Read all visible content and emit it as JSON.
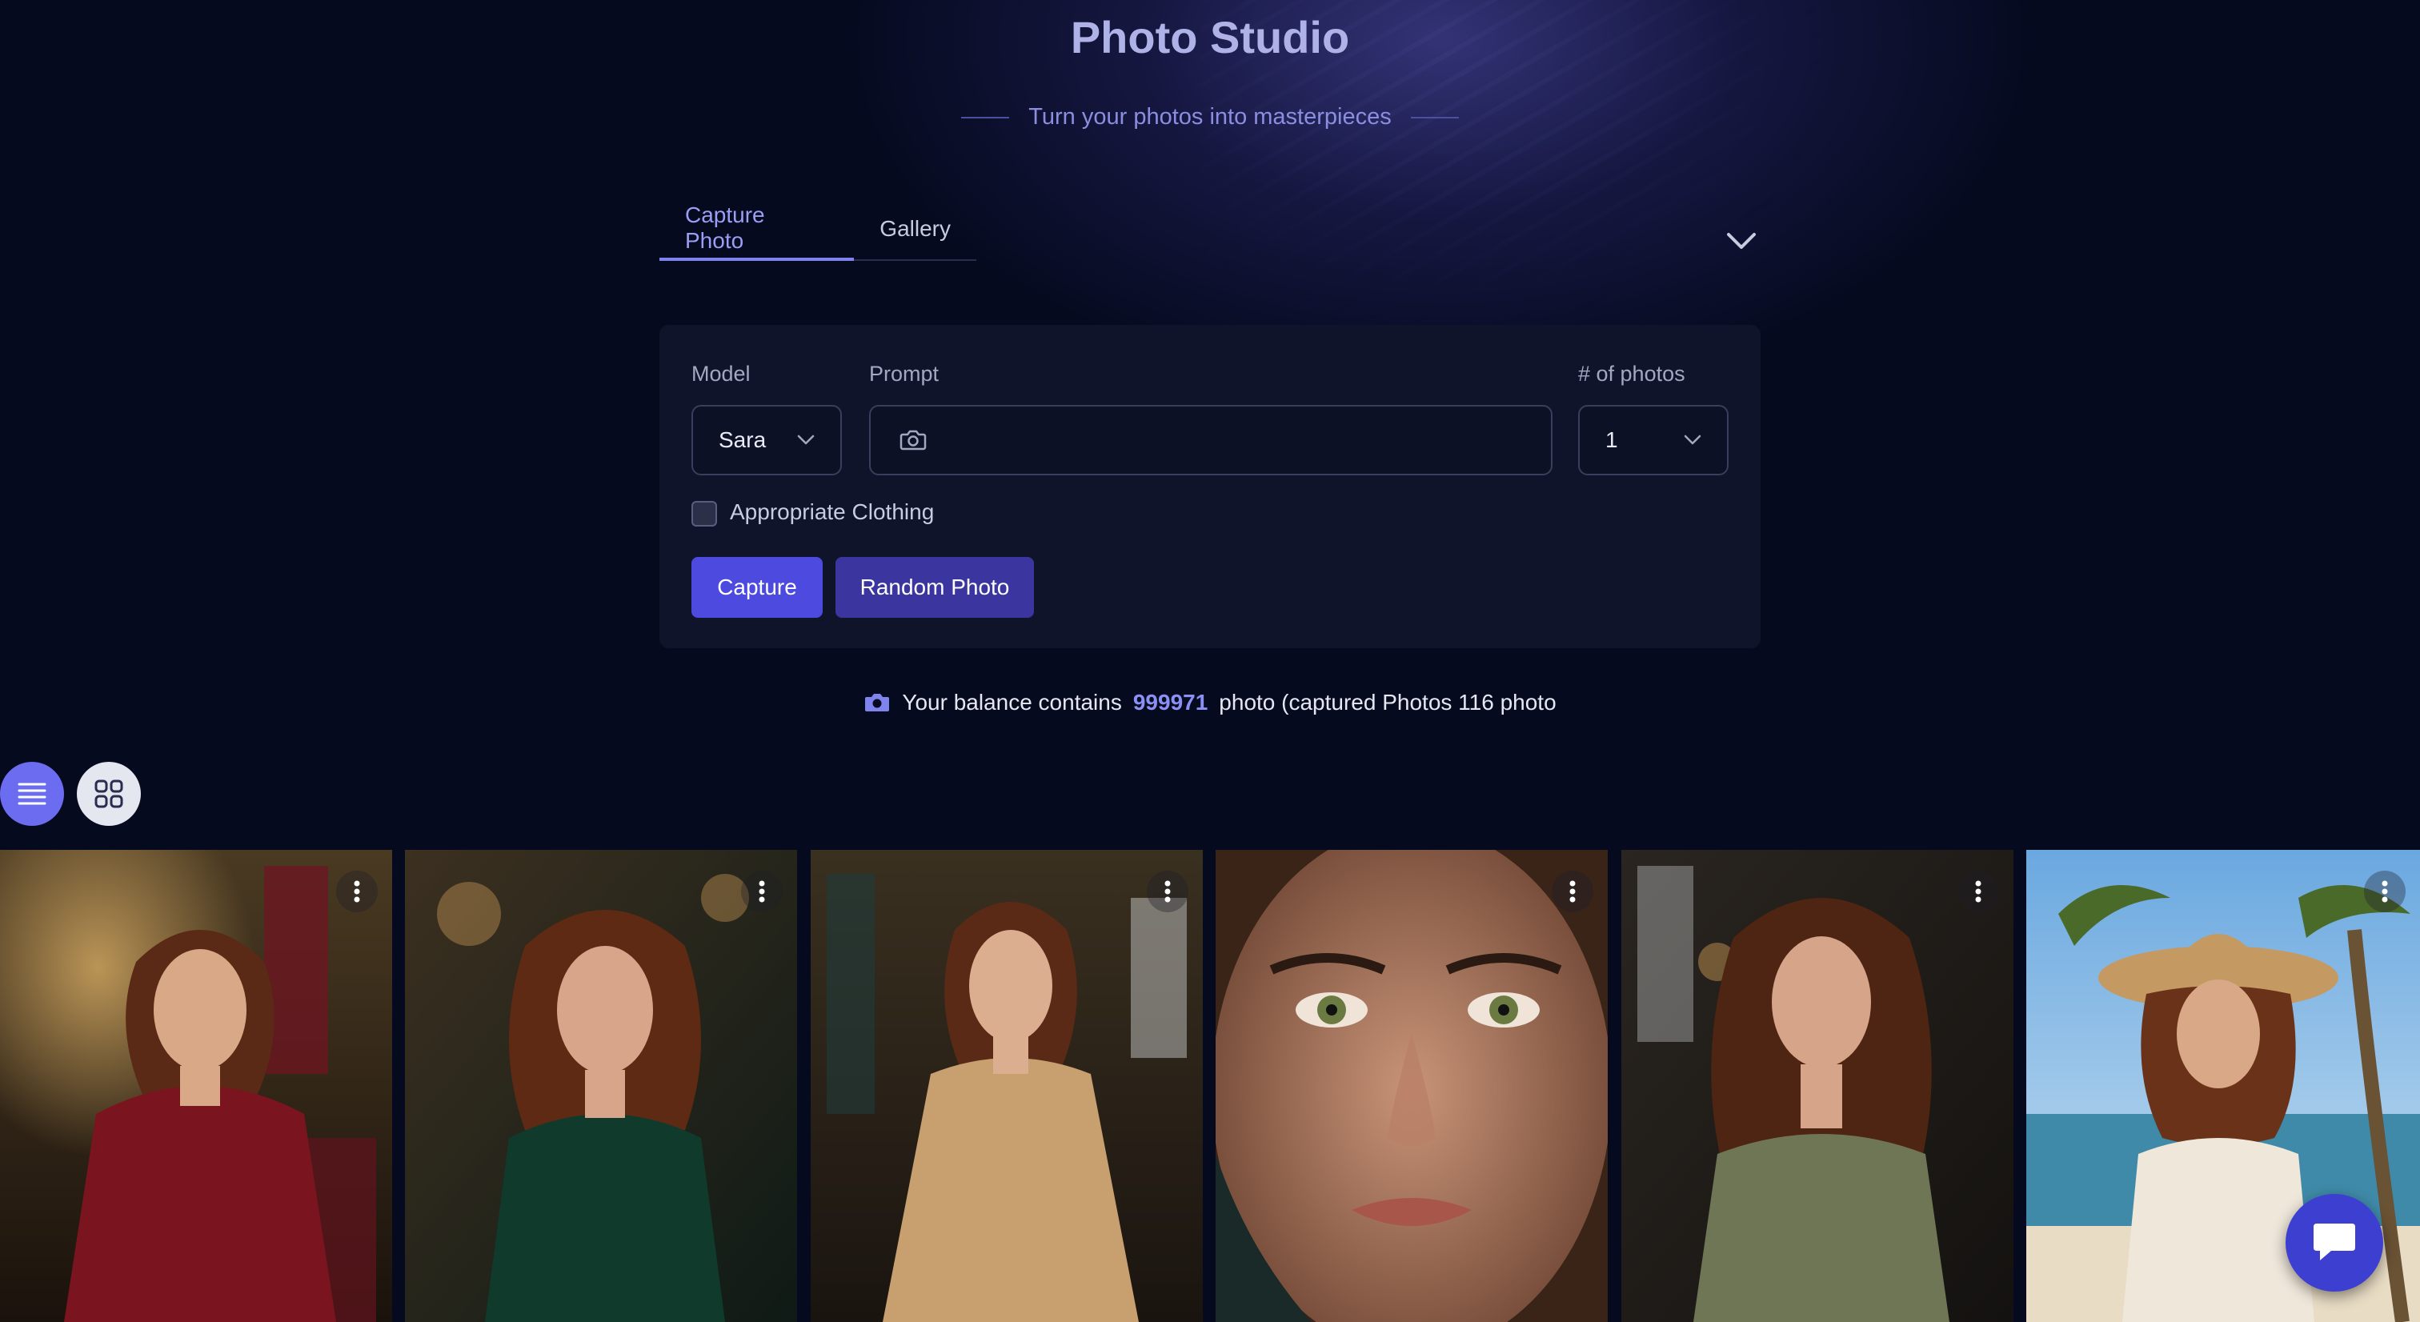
{
  "header": {
    "title": "Photo Studio",
    "subtitle": "Turn your photos into masterpieces"
  },
  "tabs": [
    {
      "label": "Capture Photo",
      "active": true
    },
    {
      "label": "Gallery",
      "active": false
    }
  ],
  "form": {
    "model_label": "Model",
    "model_value": "Sara",
    "prompt_label": "Prompt",
    "prompt_value": "",
    "count_label": "# of photos",
    "count_value": "1",
    "checkbox_label": "Appropriate Clothing",
    "checkbox_checked": false,
    "capture_button": "Capture",
    "random_button": "Random Photo"
  },
  "balance": {
    "prefix": "Your balance contains",
    "amount": "999971",
    "suffix": "photo (captured Photos 116 photo"
  },
  "view_toggle": {
    "list_icon": "list-icon",
    "grid_icon": "grid-icon",
    "active": "list"
  },
  "gallery": {
    "photos": [
      {
        "name": "photo-woman-red-dress",
        "icon": "more-vertical-icon"
      },
      {
        "name": "photo-woman-green-dress",
        "icon": "more-vertical-icon"
      },
      {
        "name": "photo-woman-gold-dress",
        "icon": "more-vertical-icon"
      },
      {
        "name": "photo-face-closeup",
        "icon": "more-vertical-icon"
      },
      {
        "name": "photo-woman-sage-dress",
        "icon": "more-vertical-icon"
      },
      {
        "name": "photo-woman-beach-hat",
        "icon": "more-vertical-icon"
      }
    ]
  },
  "colors": {
    "background": "#060a1f",
    "accent": "#4d4adf",
    "accent_dark": "#3b369f",
    "tab_active": "#9a9ef5",
    "balance_number": "#8b90f5"
  }
}
